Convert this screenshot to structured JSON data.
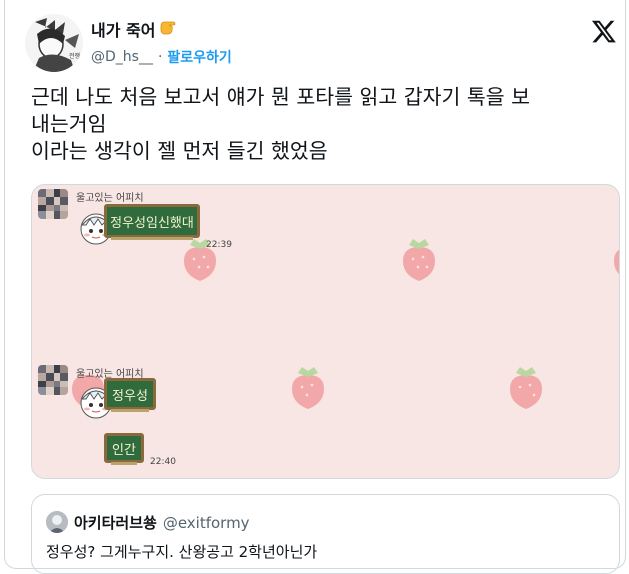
{
  "author": {
    "display_name": "내가 죽어",
    "emoji_icon": "pointing-hand-icon",
    "handle": "@D_hs__",
    "separator": "·",
    "follow_label": "팔로우하기"
  },
  "tweet": {
    "lines": [
      "근데 나도 처음 보고서 얘가 뭔 포타를 읽고 갑자기 톡을 보",
      "내는거임",
      "이라는 생각이 젤 먼저 들긴 했었음"
    ]
  },
  "media": {
    "background": "#f8e6e4",
    "messages": [
      {
        "sender": "울고있는 어피치",
        "bubbles": [
          "정우성임신했대"
        ],
        "time": "22:39"
      },
      {
        "sender": "울고있는 어피치",
        "bubbles": [
          "정우성",
          "인간"
        ],
        "time": "22:40"
      }
    ]
  },
  "quote": {
    "display_name": "아키타러브쑝",
    "handle": "@exitformy",
    "text": "정우성? 그게누구지. 산왕공고 2학년아닌가"
  },
  "colors": {
    "accent": "#1d9bf0",
    "muted": "#536471",
    "border": "#cfd9de",
    "chalkboard": "#2f6b3d"
  }
}
